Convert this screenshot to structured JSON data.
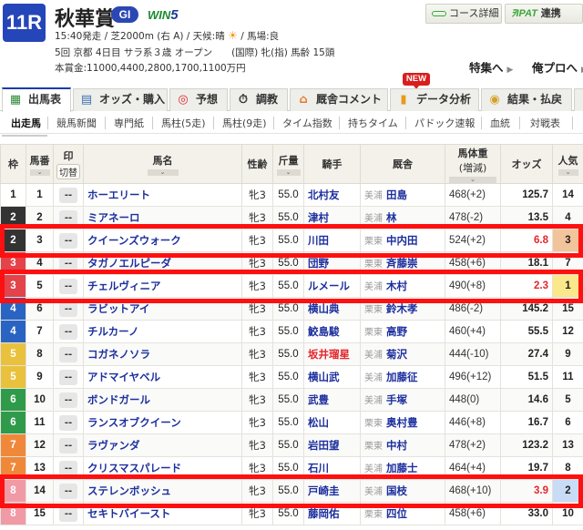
{
  "race": {
    "number": "11R",
    "title": "秋華賞",
    "grade": "GI",
    "win5_prefix": "WIN",
    "win5_suffix": "5",
    "line1_pre": "15:40発走 / 芝2000m (右 A) / 天候:晴",
    "weather_icon": "sun-icon",
    "line1_post": "/ 馬場:良",
    "line2": "5回 京都 4日目 サラ系３歳 オープン　　(国際) 牝(指) 馬齢 15頭",
    "line3": "本賞金:11000,4400,2800,1700,1100万円"
  },
  "top_buttons": {
    "course_detail": "コース詳細",
    "ipat_logo": "IPAT",
    "ipat_label": "連携"
  },
  "top_links": {
    "special": "特集へ",
    "orepro": "俺プロへ"
  },
  "tabs": [
    {
      "label": "出馬表",
      "icon": "table-icon",
      "active": true
    },
    {
      "label": "オッズ・購入",
      "icon": "odds-icon"
    },
    {
      "label": "予想",
      "icon": "target-icon"
    },
    {
      "label": "調教",
      "icon": "stopwatch-icon"
    },
    {
      "label": "厩舎コメント",
      "icon": "stable-icon"
    },
    {
      "label": "データ分析",
      "icon": "bar-chart-icon",
      "badge": "NEW"
    },
    {
      "label": "結果・払戻",
      "icon": "coins-icon"
    }
  ],
  "subtabs": [
    "出走馬",
    "競馬新聞",
    "専門紙",
    "馬柱(5走)",
    "馬柱(9走)",
    "タイム指数",
    "持ちタイム",
    "パドック速報",
    "血統",
    "対戦表"
  ],
  "table": {
    "headers": {
      "waku": "枠",
      "umaban": "馬番",
      "mark": "印",
      "mark_switch": "切替",
      "horse": "馬名",
      "sexage": "性齢",
      "weight": "斤量",
      "jockey": "騎手",
      "stable": "厩舎",
      "bodyweight": "馬体重",
      "bodyweight_sub": "(増減)",
      "odds": "オッズ",
      "popularity": "人気",
      "sort_icon": "⌄"
    },
    "mark_placeholder": "--",
    "rows": [
      {
        "waku": "1",
        "umaban": "1",
        "horse": "ホーエリート",
        "sexage": "牝3",
        "weight": "55.0",
        "jockey": "北村友",
        "region": "美浦",
        "trainer": "田島",
        "bw": "468(+2)",
        "odds": "125.7",
        "pop": "14"
      },
      {
        "waku": "2",
        "umaban": "2",
        "horse": "ミアネーロ",
        "sexage": "牝3",
        "weight": "55.0",
        "jockey": "津村",
        "region": "美浦",
        "trainer": "林",
        "bw": "478(-2)",
        "odds": "13.5",
        "pop": "4"
      },
      {
        "waku": "2",
        "umaban": "3",
        "horse": "クイーンズウォーク",
        "sexage": "牝3",
        "weight": "55.0",
        "jockey": "川田",
        "region": "栗東",
        "trainer": "中内田",
        "bw": "524(+2)",
        "odds": "6.8",
        "pop": "3"
      },
      {
        "waku": "3",
        "umaban": "4",
        "horse": "タガノエルピーダ",
        "sexage": "牝3",
        "weight": "55.0",
        "jockey": "団野",
        "region": "栗東",
        "trainer": "斉藤崇",
        "bw": "458(+6)",
        "odds": "18.1",
        "pop": "7"
      },
      {
        "waku": "3",
        "umaban": "5",
        "horse": "チェルヴィニア",
        "sexage": "牝3",
        "weight": "55.0",
        "jockey": "ルメール",
        "region": "美浦",
        "trainer": "木村",
        "bw": "490(+8)",
        "odds": "2.3",
        "pop": "1"
      },
      {
        "waku": "4",
        "umaban": "6",
        "horse": "ラビットアイ",
        "sexage": "牝3",
        "weight": "55.0",
        "jockey": "横山典",
        "region": "栗東",
        "trainer": "鈴木孝",
        "bw": "486(-2)",
        "odds": "145.2",
        "pop": "15"
      },
      {
        "waku": "4",
        "umaban": "7",
        "horse": "チルカーノ",
        "sexage": "牝3",
        "weight": "55.0",
        "jockey": "鮫島駿",
        "region": "栗東",
        "trainer": "高野",
        "bw": "460(+4)",
        "odds": "55.5",
        "pop": "12"
      },
      {
        "waku": "5",
        "umaban": "8",
        "horse": "コガネノソラ",
        "sexage": "牝3",
        "weight": "55.0",
        "jockey": "坂井瑠星",
        "jockey_red": true,
        "region": "美浦",
        "trainer": "菊沢",
        "bw": "444(-10)",
        "odds": "27.4",
        "pop": "9"
      },
      {
        "waku": "5",
        "umaban": "9",
        "horse": "アドマイヤベル",
        "sexage": "牝3",
        "weight": "55.0",
        "jockey": "横山武",
        "region": "美浦",
        "trainer": "加藤征",
        "bw": "496(+12)",
        "odds": "51.5",
        "pop": "11"
      },
      {
        "waku": "6",
        "umaban": "10",
        "horse": "ボンドガール",
        "sexage": "牝3",
        "weight": "55.0",
        "jockey": "武豊",
        "region": "美浦",
        "trainer": "手塚",
        "bw": "448(0)",
        "odds": "14.6",
        "pop": "5"
      },
      {
        "waku": "6",
        "umaban": "11",
        "horse": "ランスオブクイーン",
        "sexage": "牝3",
        "weight": "55.0",
        "jockey": "松山",
        "region": "栗東",
        "trainer": "奥村豊",
        "bw": "446(+8)",
        "odds": "16.7",
        "pop": "6"
      },
      {
        "waku": "7",
        "umaban": "12",
        "horse": "ラヴァンダ",
        "sexage": "牝3",
        "weight": "55.0",
        "jockey": "岩田望",
        "region": "栗東",
        "trainer": "中村",
        "bw": "478(+2)",
        "odds": "123.2",
        "pop": "13"
      },
      {
        "waku": "7",
        "umaban": "13",
        "horse": "クリスマスパレード",
        "sexage": "牝3",
        "weight": "55.0",
        "jockey": "石川",
        "region": "美浦",
        "trainer": "加藤士",
        "bw": "464(+4)",
        "odds": "19.7",
        "pop": "8"
      },
      {
        "waku": "8",
        "umaban": "14",
        "horse": "ステレンボッシュ",
        "sexage": "牝3",
        "weight": "55.0",
        "jockey": "戸崎圭",
        "region": "美浦",
        "trainer": "国枝",
        "bw": "468(+10)",
        "odds": "3.9",
        "pop": "2"
      },
      {
        "waku": "8",
        "umaban": "15",
        "horse": "セキトバイースト",
        "sexage": "牝3",
        "weight": "55.0",
        "jockey": "藤岡佑",
        "region": "栗東",
        "trainer": "四位",
        "bw": "458(+6)",
        "odds": "33.0",
        "pop": "10"
      }
    ]
  },
  "colors": {
    "waku": {
      "1": {
        "bg": "#ffffff",
        "fg": "#222222"
      },
      "2": {
        "bg": "#333333",
        "fg": "#ffffff"
      },
      "3": {
        "bg": "#e3434b",
        "fg": "#ffffff"
      },
      "4": {
        "bg": "#2a64c2",
        "fg": "#ffffff"
      },
      "5": {
        "bg": "#e9c13c",
        "fg": "#ffffff"
      },
      "6": {
        "bg": "#2f9b4a",
        "fg": "#ffffff"
      },
      "7": {
        "bg": "#f0883a",
        "fg": "#ffffff"
      },
      "8": {
        "bg": "#f09aa6",
        "fg": "#ffffff"
      }
    },
    "pop": {
      "1": "#fbe88a",
      "2": "#c8dcf6",
      "3": "#f2c49c"
    },
    "highlight": "#ff1010",
    "accent": "#2546b8"
  },
  "highlighted_umaban": [
    "3",
    "5",
    "14"
  ]
}
